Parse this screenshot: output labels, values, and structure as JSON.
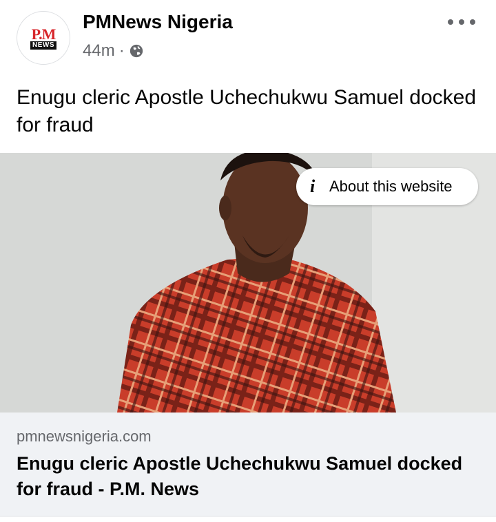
{
  "post": {
    "page_name": "PMNews Nigeria",
    "timestamp": "44m",
    "separator": "·",
    "privacy_icon": "globe-icon",
    "avatar_logo_top": "P.M",
    "avatar_logo_bottom": "NEWS",
    "text": "Enugu cleric Apostle Uchechukwu Samuel docked for fraud",
    "more_icon": "more-horizontal-icon"
  },
  "link": {
    "about_label": "About this website",
    "about_icon": "info-icon",
    "domain": "pmnewsnigeria.com",
    "title": "Enugu cleric Apostle Uchechukwu Samuel docked for fraud - P.M. News"
  },
  "colors": {
    "logo_red": "#d7262b",
    "secondary_text": "#65676b",
    "preview_bg": "#f0f2f5"
  }
}
